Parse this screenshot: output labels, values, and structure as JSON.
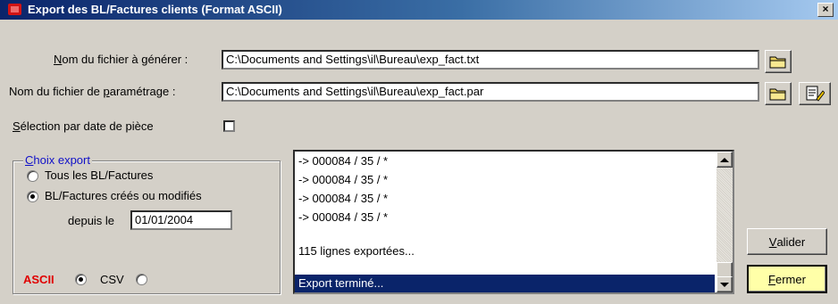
{
  "window": {
    "title": "Export des BL/Factures clients (Format ASCII)",
    "close_label": "×"
  },
  "fields": {
    "output_file": {
      "label_underlined": "N",
      "label_rest": "om du fichier à générer :",
      "value": "C:\\Documents and Settings\\il\\Bureau\\exp_fact.txt"
    },
    "param_file": {
      "label_before": "Nom du fichier de ",
      "label_underlined": "p",
      "label_after": "aramétrage :",
      "value": "C:\\Documents and Settings\\il\\Bureau\\exp_fact.par"
    }
  },
  "selection_by_date": {
    "label_underlined": "S",
    "label_rest": "élection par date de pièce",
    "checked": false
  },
  "export_choice": {
    "legend_underlined": "C",
    "legend_rest": "hoix export",
    "option_all": "Tous les BL/Factures",
    "option_modified": "BL/Factures créés ou modifiés",
    "selected": "modified",
    "since_label": "depuis le",
    "since_date": "01/01/2004"
  },
  "format": {
    "ascii_label": "ASCII",
    "csv_label": "CSV",
    "selected": "ASCII",
    "ascii_color": "#e00000"
  },
  "log": {
    "lines": [
      "-> 000084 / 35 / *",
      "-> 000084 / 35 / *",
      "-> 000084 / 35 / *",
      "-> 000084 / 35 / *"
    ],
    "summary": "115 lignes exportées...",
    "status": "Export terminé..."
  },
  "buttons": {
    "validate_underlined": "V",
    "validate_rest": "alider",
    "close_underlined": "F",
    "close_rest": "ermer",
    "close_bg": "#ffffa8"
  }
}
